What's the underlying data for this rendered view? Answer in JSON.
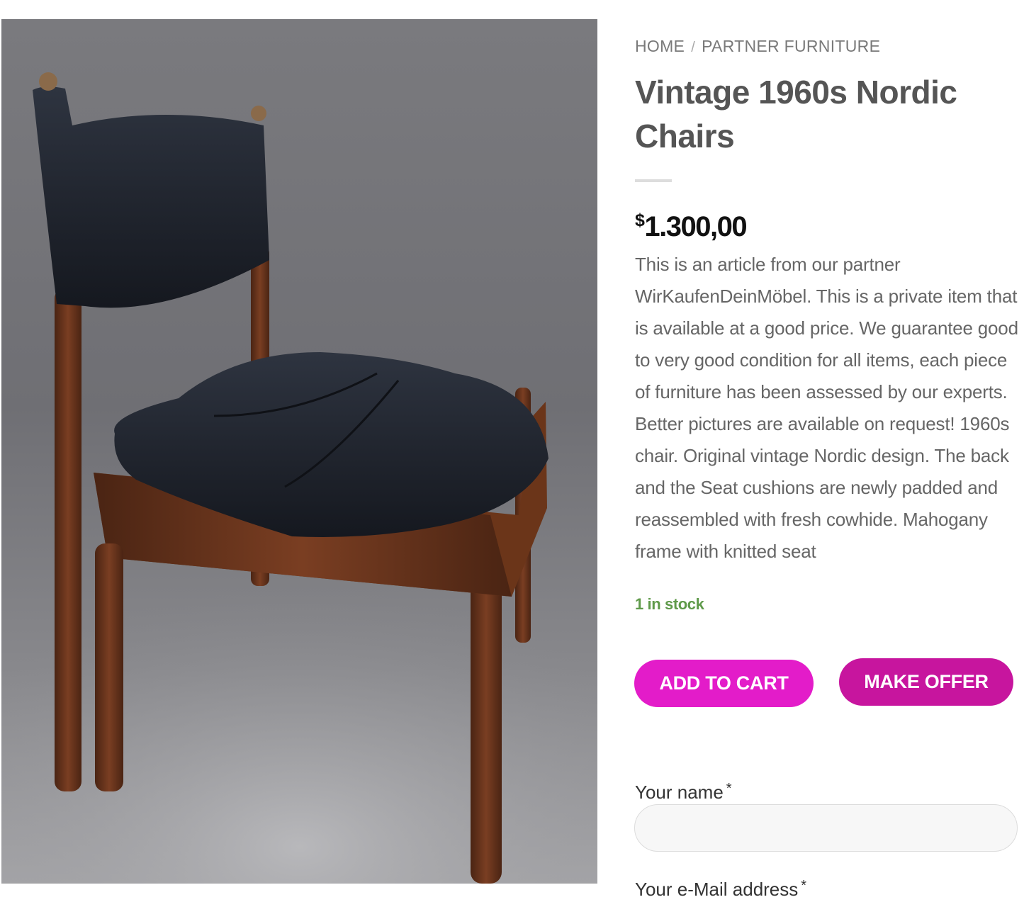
{
  "breadcrumb": {
    "home": "HOME",
    "separator": "/",
    "category": "PARTNER FURNITURE"
  },
  "product": {
    "title": "Vintage 1960s Nordic Chairs",
    "currency_symbol": "$",
    "price": "1.300,00",
    "description": "This is an article from our partner WirKaufenDeinMöbel. This is a private item that is available at a good price. We guarantee good to very good condition for all items, each piece of furniture has been assessed by our experts. Better pictures are available on request! 1960s chair. Original vintage Nordic design. The back and the Seat cushions are newly padded and reassembled with fresh cowhide. Mahogany frame with knitted seat",
    "stock": "1 in stock",
    "image_icon": "chair-photo"
  },
  "actions": {
    "add_to_cart": "ADD TO CART",
    "make_offer": "MAKE OFFER"
  },
  "form": {
    "name_label": "Your name",
    "name_value": "",
    "email_label": "Your e-Mail address",
    "required_marker": "*"
  },
  "colors": {
    "add_to_cart_bg": "#e31cc9",
    "make_offer_bg": "#c7159e",
    "stock_text": "#5f9a4a"
  }
}
